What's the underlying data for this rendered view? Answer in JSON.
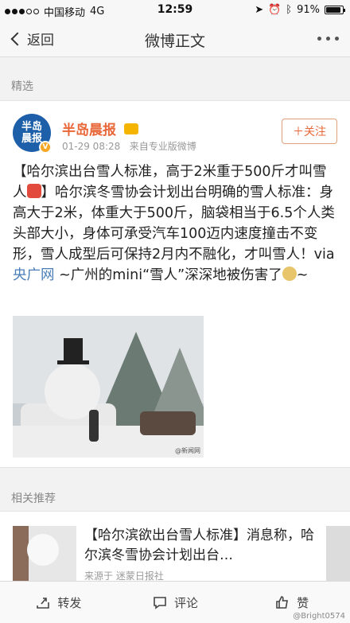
{
  "status_bar": {
    "carrier": "中国移动",
    "network": "4G",
    "time": "12:59",
    "battery": "91%",
    "battery_level": 0.91
  },
  "nav": {
    "back_label": "返回",
    "title": "微博正文"
  },
  "featured_label": "精选",
  "post": {
    "avatar_text": "半岛晨报",
    "author": "半岛晨报",
    "timestamp": "01-29 08:28",
    "source": "来自专业版微博",
    "follow_label": "＋关注",
    "text_part1": "【哈尔滨出台雪人标准，高于2米重于500斤才叫雪人",
    "text_part2": "】哈尔滨冬雪协会计划出台明确的雪人标准：身高大于2米，体重大于500斤，脑袋相当于6.5个人类头部大小，身体可承受汽车100迈内速度撞击不变形，雪人成型后可保持2月内不融化，才叫雪人！via",
    "link1": "央广网",
    "text_part3": " ~广州的mini“雪人”深深地被伤害了",
    "text_part4": "~",
    "image_watermark": "@新闻网"
  },
  "related": {
    "label": "相关推荐",
    "title": "【哈尔滨欲出台雪人标准】消息称，哈尔滨冬雪协会计划出台…",
    "source": "来源于 迷蒙日报社"
  },
  "tabbar": {
    "repost": "转发",
    "comment": "评论",
    "like": "赞",
    "watermark": "@Bright0574"
  },
  "colors": {
    "accent": "#e8683a",
    "link": "#4b7eb8"
  }
}
